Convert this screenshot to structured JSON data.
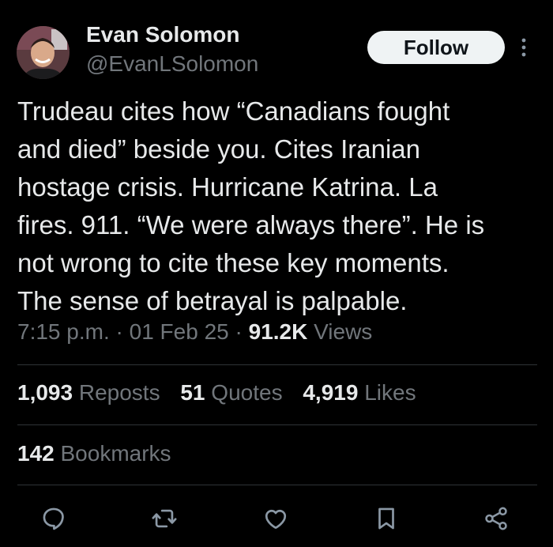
{
  "author": {
    "name": "Evan Solomon",
    "handle": "@EvanLSolomon",
    "avatar": "avatar-photo"
  },
  "header": {
    "follow_label": "Follow",
    "more_icon": "more-vertical-icon"
  },
  "tweet": {
    "lines": [
      "Trudeau cites how “Canadians fought",
      "and died” beside you. Cites Iranian",
      "hostage crisis. Hurricane Katrina. La",
      "fires. 911. “We were always there”. He is",
      "not wrong to cite these key moments.",
      "The sense of betrayal is palpable."
    ]
  },
  "meta": {
    "time": "7:15 p.m.",
    "sep1": "·",
    "date": "01 Feb 25",
    "sep2": "·",
    "views_count": "91.2K",
    "views_label": "Views"
  },
  "stats": {
    "reposts_count": "1,093",
    "reposts_label": "Reposts",
    "quotes_count": "51",
    "quotes_label": "Quotes",
    "likes_count": "4,919",
    "likes_label": "Likes",
    "bookmarks_count": "142",
    "bookmarks_label": "Bookmarks"
  },
  "actions": {
    "icons": [
      "reply-icon",
      "repost-icon",
      "like-icon",
      "bookmark-icon",
      "share-icon"
    ],
    "icon_color": "#8b98a5"
  },
  "colors": {
    "background": "#000000",
    "text": "#e7e9ea",
    "secondary": "#71767b",
    "divider": "#2f3336",
    "button_bg": "#eff3f4"
  }
}
